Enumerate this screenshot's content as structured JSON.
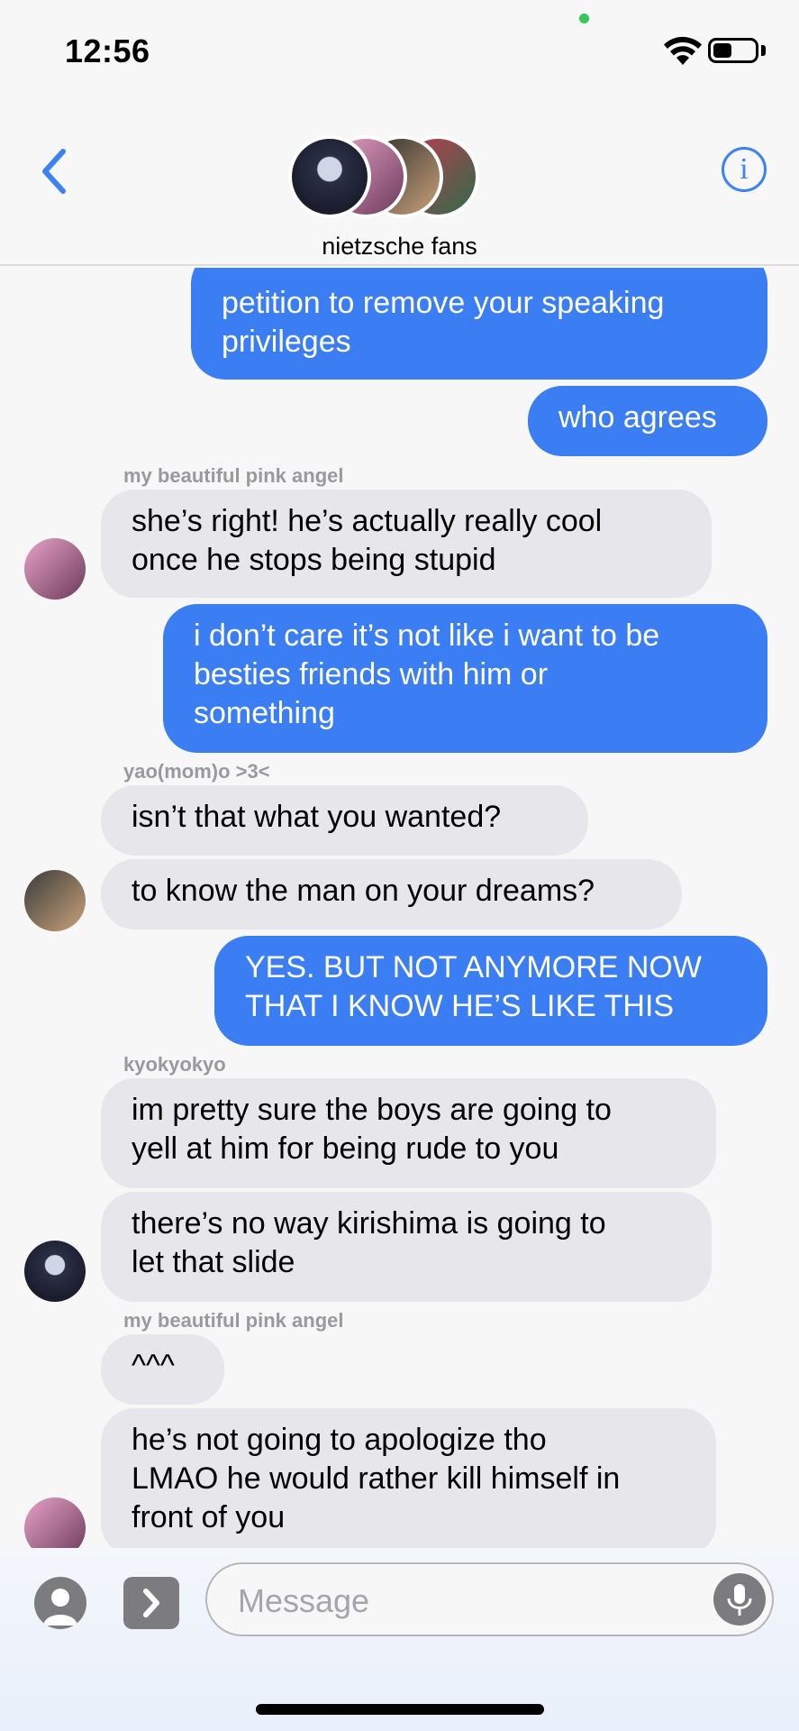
{
  "status_bar": {
    "time": "12:56",
    "battery_level": 0.45
  },
  "header": {
    "back_icon": "chevron-left-icon",
    "group_name": "nietzsche fans",
    "info_icon": "info-icon"
  },
  "messages": [
    {
      "dir": "out",
      "text": "petition to remove your speaking\nprivileges"
    },
    {
      "dir": "out",
      "text": "who agrees"
    },
    {
      "dir": "in",
      "sender": "my beautiful pink angel",
      "text": "she’s right! he’s actually really cool\nonce he stops being stupid"
    },
    {
      "dir": "out",
      "text": "i don’t care it’s not like i want to be\nbesties friends with him or\nsomething"
    },
    {
      "dir": "in",
      "sender": "yao(mom)o >3<",
      "text": "isn’t that what you wanted?"
    },
    {
      "dir": "in",
      "text": "to know the man on your dreams?"
    },
    {
      "dir": "out",
      "text": "YES. BUT NOT ANYMORE NOW\nTHAT I KNOW HE’S LIKE THIS"
    },
    {
      "dir": "in",
      "sender": "kyokyokyo",
      "text": "im pretty sure the boys are going to\nyell at him for being rude to you"
    },
    {
      "dir": "in",
      "text": "there’s no way kirishima is going to\nlet that slide"
    },
    {
      "dir": "in",
      "sender": "my beautiful pink angel",
      "text": "^^^"
    },
    {
      "dir": "in",
      "text": "he’s not going to apologize tho\nLMAO he would rather kill himself in\nfront of you"
    }
  ],
  "composer": {
    "placeholder": "Message"
  },
  "colors": {
    "outgoing": "#3b7df2",
    "incoming": "#e6e6eb",
    "accent": "#3b82f6"
  }
}
